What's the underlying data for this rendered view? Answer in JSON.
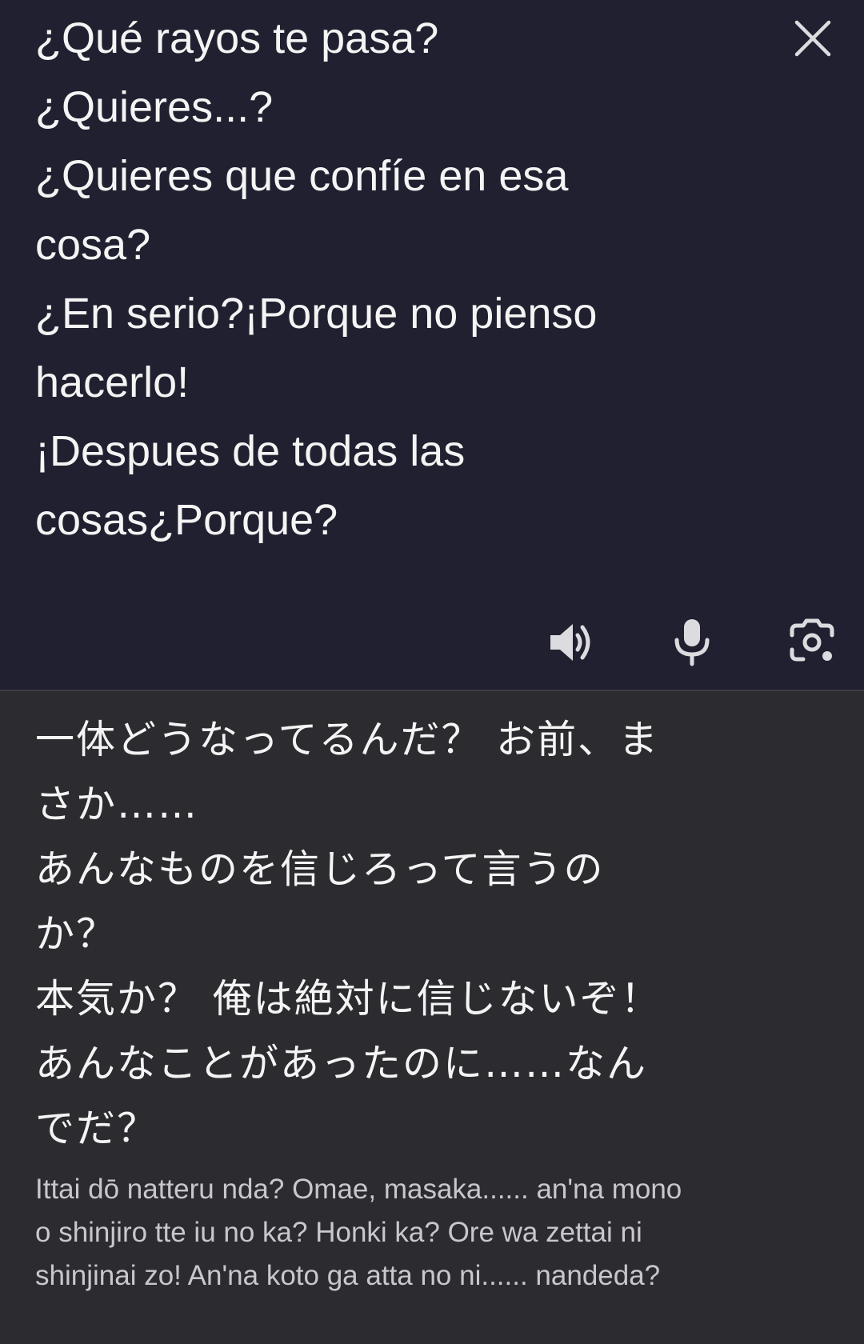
{
  "source": {
    "lines": [
      "¿Qué rayos te pasa?",
      "¿Quieres...?",
      "¿Quieres que confíe en esa",
      "cosa?",
      "¿En serio?¡Porque no pienso",
      "hacerlo!",
      "¡Despues de todas las",
      "cosas¿Porque?"
    ]
  },
  "translation": {
    "lines": [
      "一体どうなってるんだ？ お前、ま",
      "さか……",
      "あんなものを信じろって言うの",
      "か？",
      "本気か？ 俺は絶対に信じないぞ！",
      "あんなことがあったのに……なん",
      "でだ？"
    ],
    "transliteration_lines": [
      "Ittai dō natteru nda? Omae, masaka...... an'na mono",
      "o shinjiro tte iu no ka? Honki ka? Ore wa zettai ni",
      "shinjinai zo! An'na koto ga atta no ni...... nandeda?"
    ]
  },
  "icons": {
    "close": "close-icon",
    "speaker": "speaker-icon",
    "microphone": "microphone-icon",
    "camera": "camera-lens-icon"
  },
  "colors": {
    "source_background": "#202030",
    "translation_background": "#2c2c30",
    "primary_text": "#f4f4f4",
    "secondary_text": "#c7c7cc",
    "icon": "#dcdce0"
  }
}
